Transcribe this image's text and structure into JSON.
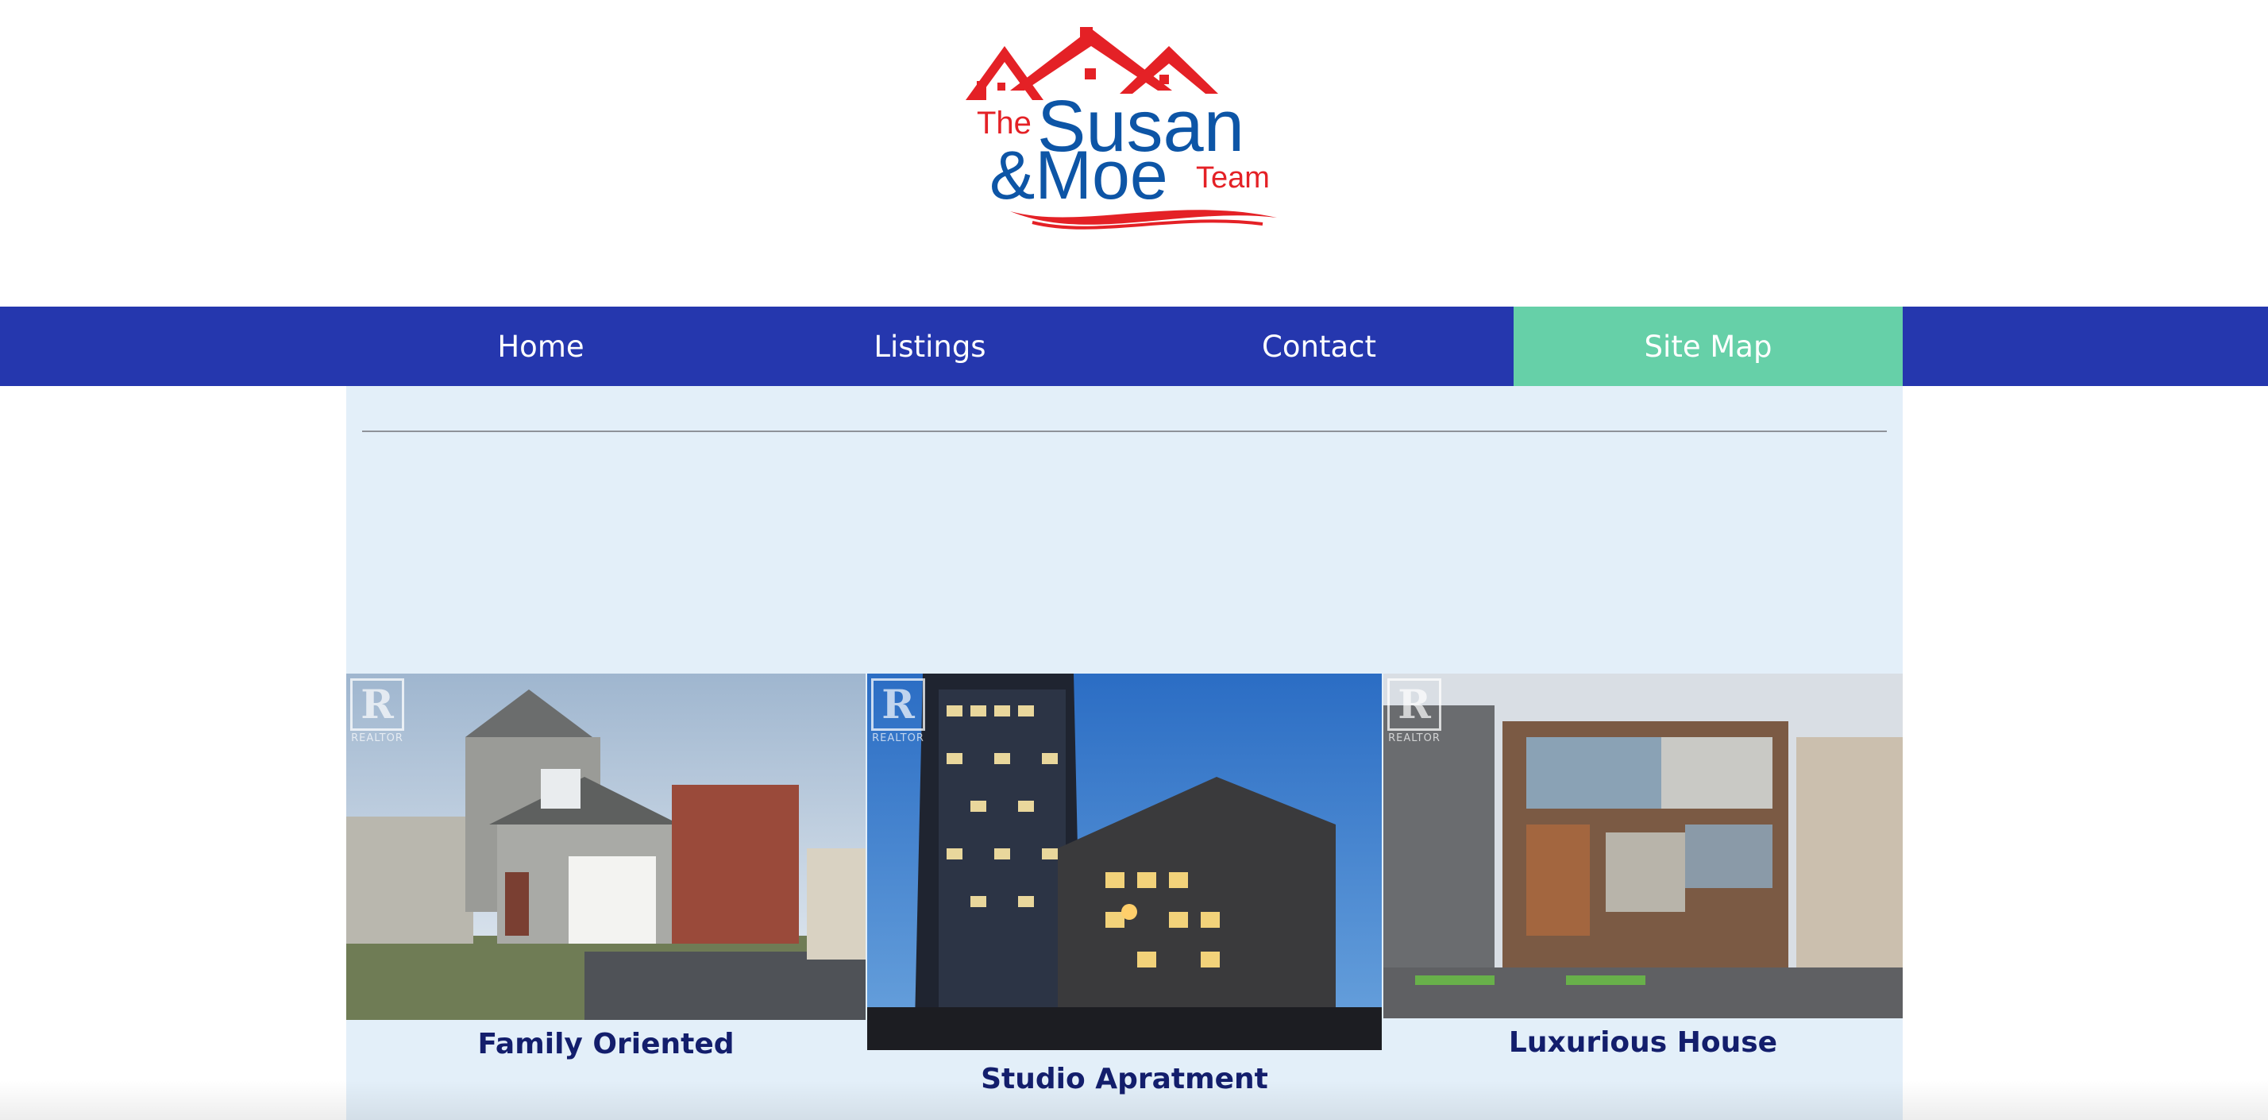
{
  "logo": {
    "line1_the": "The",
    "line1_susan": "Susan",
    "line2_amp_moe": "&Moe",
    "line2_team": "Team",
    "colors": {
      "red": "#e42126",
      "blue": "#0d55a6"
    }
  },
  "nav": {
    "items": [
      {
        "label": "Home",
        "active": false
      },
      {
        "label": "Listings",
        "active": false
      },
      {
        "label": "Contact",
        "active": false
      },
      {
        "label": "Site Map",
        "active": true
      }
    ],
    "colors": {
      "bar": "#2537ae",
      "active": "#66d0a8"
    }
  },
  "listings": [
    {
      "title": "Family Oriented",
      "watermark": "REALTOR"
    },
    {
      "title": "Studio Apratment",
      "watermark": "REALTOR"
    },
    {
      "title": "Luxurious House",
      "watermark": "REALTOR"
    }
  ]
}
